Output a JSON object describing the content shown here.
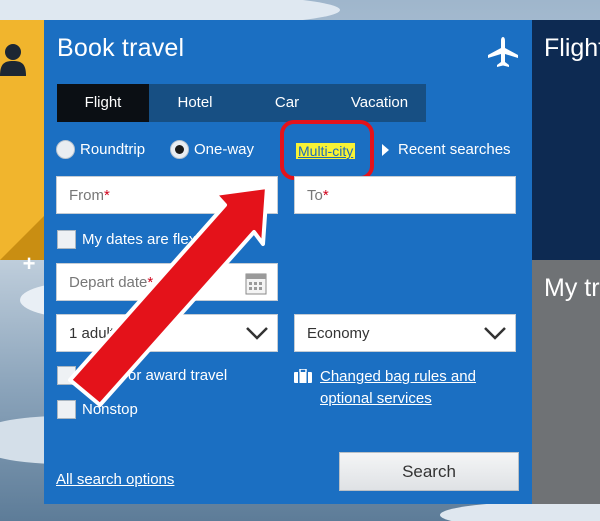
{
  "booking": {
    "title": "Book travel",
    "tabs": [
      {
        "label": "Flight"
      },
      {
        "label": "Hotel"
      },
      {
        "label": "Car"
      },
      {
        "label": "Vacation"
      }
    ],
    "trip_type": {
      "roundtrip": "Roundtrip",
      "oneway": "One-way",
      "multicity": "Multi-city",
      "selected": "One-way"
    },
    "recent_searches": "Recent searches",
    "from": {
      "placeholder": "From",
      "required": "*"
    },
    "to": {
      "placeholder": "To",
      "required": "*"
    },
    "flexible_dates": "My dates are flexib",
    "depart_date": {
      "placeholder": "Depart date",
      "required": "*"
    },
    "passengers": {
      "value": "1 adult"
    },
    "cabin": {
      "value": "Economy"
    },
    "award_travel": "or award travel",
    "nonstop": "Nonstop",
    "bag_rules": {
      "line1": "Changed bag rules and",
      "line2": "optional services"
    },
    "all_options": "All search options",
    "search_button": "Search"
  },
  "side_panels": {
    "top": "Flight",
    "bottom": "My tr"
  },
  "colors": {
    "panel": "#1b6fc2",
    "tab_bar": "#174f83",
    "tab_active": "#0b0f14",
    "highlight": "#f7f235",
    "annotation": "#e4121a",
    "left_tile": "#f1b52d"
  },
  "icons": [
    "user-icon",
    "plus-icon",
    "airplane-icon",
    "calendar-icon",
    "chevron-down-icon",
    "briefcase-icon",
    "triangle-right-icon"
  ]
}
